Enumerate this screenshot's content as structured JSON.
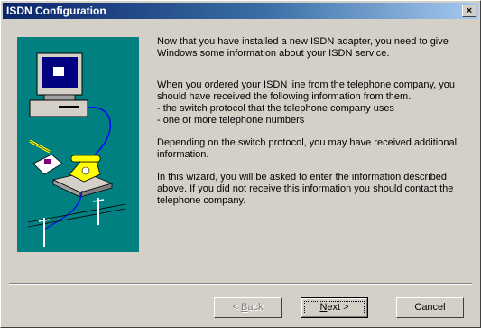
{
  "window": {
    "title": "ISDN Configuration",
    "close_label": "×"
  },
  "content": {
    "paragraphs": [
      "Now that you have installed a new ISDN adapter, you need to give Windows some information about your ISDN service.",
      "When you ordered your ISDN line from the telephone company, you should have received the following information from them.\n- the switch protocol that the telephone company uses\n- one or more telephone numbers",
      "Depending on the switch protocol, you may have received additional information.",
      "In this wizard, you will be asked to enter the information described above.  If you did not receive this information you should contact the telephone company."
    ]
  },
  "buttons": {
    "back_label": "< Back",
    "back_mnemonic": "B",
    "next_label": "Next >",
    "next_mnemonic": "N",
    "cancel_label": "Cancel"
  },
  "colors": {
    "title_bar_start": "#0a246a",
    "title_bar_end": "#a6caf0",
    "dialog_face": "#d4d0c8",
    "illustration_bg": "#008080"
  },
  "icons": {
    "illustration": "computer-phone-isdn-illustration"
  }
}
